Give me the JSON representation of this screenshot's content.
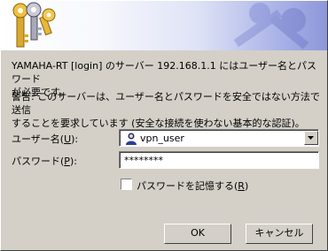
{
  "message": {
    "line1": "YAMAHA-RT [login] のサーバー 192.168.1.1 にはユーザー名とパスワード",
    "line2": "が必要です。"
  },
  "warning": {
    "line1": "警告: このサーバーは、ユーザー名とパスワードを安全ではない方法で送信",
    "line2": "することを要求しています (安全な接続を使わない基本的な認証)。"
  },
  "username": {
    "label": "ユーザー名(",
    "accel": "U",
    "label_end": "):",
    "value": "vpn_user",
    "icon": "user-icon"
  },
  "password": {
    "label": "パスワード(",
    "accel": "P",
    "label_end": "):",
    "value": "********"
  },
  "remember": {
    "label": "パスワードを記憶する(",
    "accel": "R",
    "label_end": ")",
    "checked": false
  },
  "buttons": {
    "ok": "OK",
    "cancel": "キャンセル"
  },
  "colors": {
    "dialog": "#d4d0c8",
    "banner_end": "#8d97da"
  }
}
